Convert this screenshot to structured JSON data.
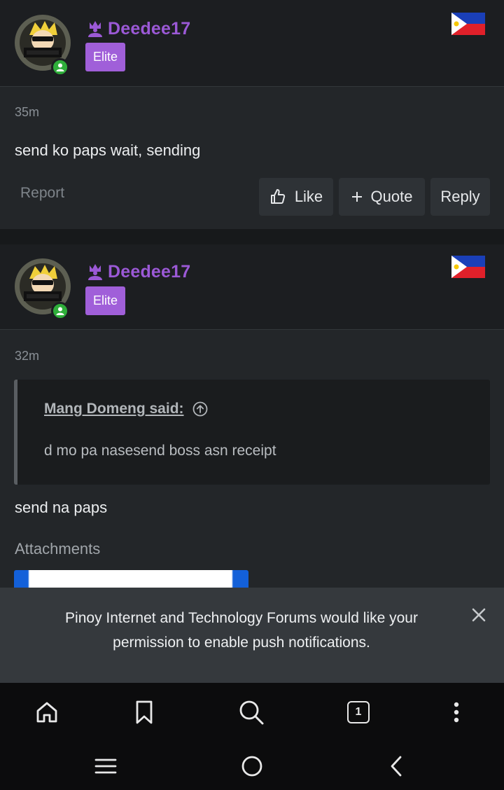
{
  "posts": [
    {
      "username": "Deedee17",
      "badge": "Elite",
      "time": "35m",
      "text": "send ko paps wait, sending",
      "actions": {
        "report": "Report",
        "like": "Like",
        "quote": "Quote",
        "reply": "Reply"
      }
    },
    {
      "username": "Deedee17",
      "badge": "Elite",
      "time": "32m",
      "quote": {
        "author": "Mang Domeng said:",
        "text": "d mo pa nasesend boss asn receipt"
      },
      "text": "send na paps",
      "attachments_label": "Attachments"
    }
  ],
  "push_banner": {
    "text": "Pinoy Internet and Technology Forums would like your permission to enable push notifications."
  },
  "browser_toolbar": {
    "tab_count": "1"
  },
  "colors": {
    "username": "#9b59d6",
    "badge": "#a05fd9",
    "online": "#2fae3a"
  }
}
